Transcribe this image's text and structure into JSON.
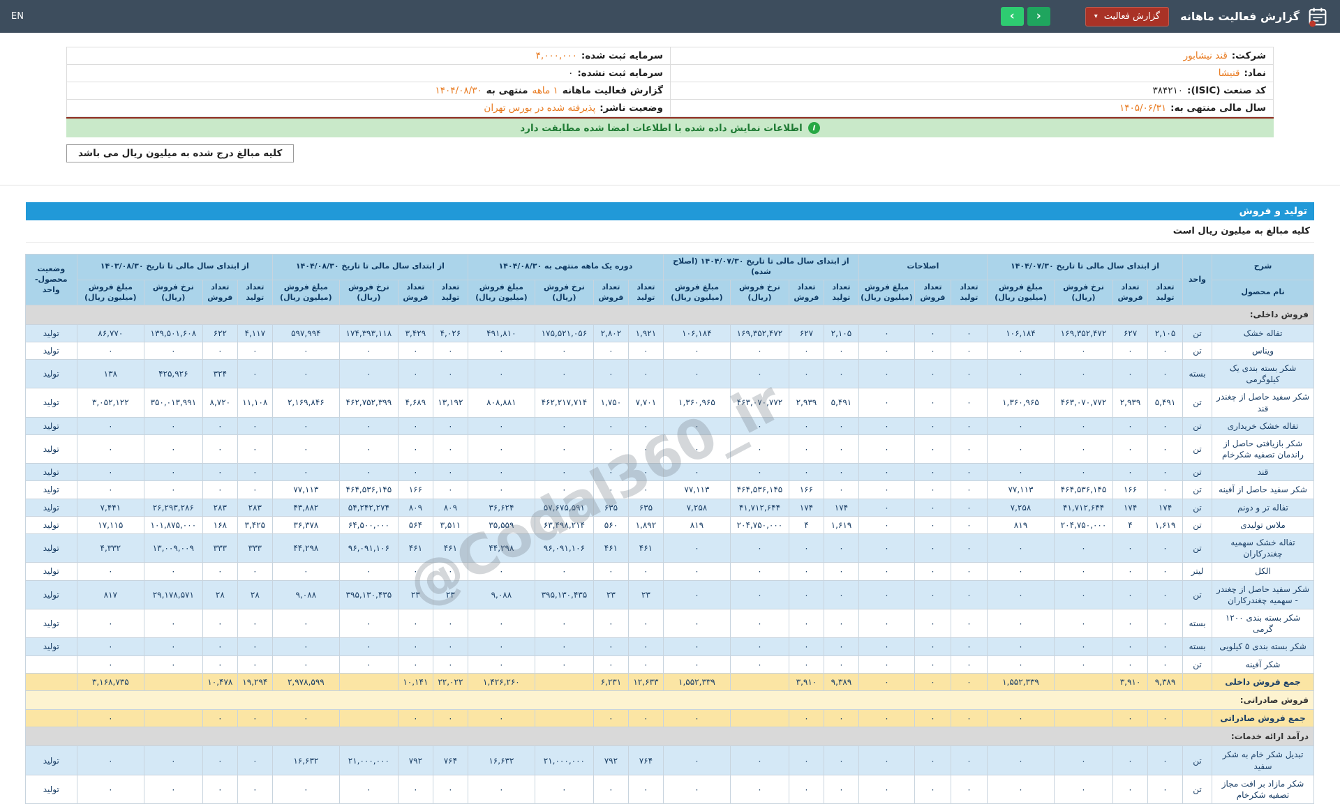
{
  "navbar": {
    "title": "گزارش فعالیت ماهانه",
    "dropdown_label": "گزارش فعالیت",
    "dropdown_caret": "▾",
    "prev_arrow": "‹",
    "next_arrow": "›",
    "lang": "EN"
  },
  "info": {
    "company_label": "شرکت:",
    "company_value": "قند نیشابور",
    "symbol_label": "نماد:",
    "symbol_value": "قنیشا",
    "isic_label": "کد صنعت (ISIC):",
    "isic_value": "۳۸۴۲۱۰",
    "fiscal_year_label": "سال مالی منتهی به:",
    "fiscal_year_value": "۱۴۰۵/۰۶/۳۱",
    "registered_capital_label": "سرمایه ثبت شده:",
    "registered_capital_value": "۴,۰۰۰,۰۰۰",
    "unregistered_capital_label": "سرمایه ثبت نشده:",
    "unregistered_capital_value": "۰",
    "report_label": "گزارش فعالیت ماهانه",
    "report_period": "۱ ماهه",
    "report_ending_label": "منتهی به",
    "report_ending_date": "۱۴۰۴/۰۸/۳۰",
    "publisher_status_label": "وضعیت ناشر:",
    "publisher_status_value": "پذیرفته شده در بورس تهران",
    "signature_notice": "اطلاعات نمایش داده شده با اطلاعات امضا شده مطابقت دارد",
    "info_icon_glyph": "i",
    "amounts_note": "کلیه مبالغ درج شده به میلیون ریال می باشد"
  },
  "section": {
    "title": "تولید و فروش",
    "subtitle": "کلیه مبالغ به میلیون ریال است"
  },
  "watermark": "@Codal360_ir",
  "colors": {
    "navbar_bg": "#3d4d5d",
    "accent_red": "#a93226",
    "accent_red_border": "#c15b4e",
    "accent_green_prev": "#1fa55e",
    "accent_green_next": "#2ecc71",
    "link_orange": "#e8791e",
    "banner_bg": "#c9e9c9",
    "banner_text": "#1e7a33",
    "banner_top_line": "#8e2a1e",
    "info_icon_green": "#27a844",
    "section_bar_blue": "#2199d8",
    "header_blue": "#abd4ea",
    "header_text": "#0f3a63",
    "row_blue": "#d4e8f6",
    "row_yellow": "#fbe5a4",
    "section_gray": "#d9d9d9",
    "section_cream": "#fdf3d0",
    "num_text": "#1b3f66",
    "grid_border": "#c8d4de"
  },
  "table": {
    "headers": {
      "sharh": "شرح",
      "product": "نام محصول",
      "unit": "واحد",
      "status_lines": [
        "وضعیت",
        "محصول-واحد"
      ],
      "sub_cols": [
        [
          "تعداد",
          "تولید"
        ],
        [
          "تعداد",
          "فروش"
        ],
        [
          "نرخ فروش",
          "(ریال)"
        ],
        [
          "مبلغ فروش",
          "(میلیون ریال)"
        ]
      ],
      "sub_cols_adj": [
        [
          "تعداد",
          "تولید"
        ],
        [
          "تعداد",
          "فروش"
        ],
        [
          "مبلغ فروش",
          "(میلیون ریال)"
        ]
      ]
    },
    "groups": [
      {
        "label": "از ابتدای سال مالی تا تاریخ ۱۴۰۴/۰۷/۳۰",
        "cols": 4
      },
      {
        "label": "اصلاحات",
        "cols": 3
      },
      {
        "label": "از ابتدای سال مالی تا تاریخ ۱۴۰۴/۰۷/۳۰ (اصلاح شده)",
        "cols": 4
      },
      {
        "label": "دوره یک ماهه منتهی به ۱۴۰۴/۰۸/۳۰",
        "cols": 4
      },
      {
        "label": "از ابتدای سال مالی تا تاریخ ۱۴۰۴/۰۸/۳۰",
        "cols": 4
      },
      {
        "label": "از ابتدای سال مالی تا تاریخ ۱۴۰۳/۰۸/۳۰",
        "cols": 4
      }
    ],
    "rows": [
      {
        "type": "section",
        "label": "فروش داخلی:",
        "tone": "gray"
      },
      {
        "type": "data",
        "name": "تفاله خشک",
        "unit": "تن",
        "status": "تولید",
        "cells": [
          "۲,۱۰۵",
          "۶۲۷",
          "۱۶۹,۳۵۲,۴۷۲",
          "۱۰۶,۱۸۴",
          "۰",
          "۰",
          "۰",
          "۲,۱۰۵",
          "۶۲۷",
          "۱۶۹,۳۵۲,۴۷۲",
          "۱۰۶,۱۸۴",
          "۱,۹۲۱",
          "۲,۸۰۲",
          "۱۷۵,۵۲۱,۰۵۶",
          "۴۹۱,۸۱۰",
          "۴,۰۲۶",
          "۳,۴۲۹",
          "۱۷۴,۳۹۳,۱۱۸",
          "۵۹۷,۹۹۴",
          "۴,۱۱۷",
          "۶۲۲",
          "۱۳۹,۵۰۱,۶۰۸",
          "۸۶,۷۷۰"
        ]
      },
      {
        "type": "data",
        "name": "ویناس",
        "unit": "تن",
        "status": "تولید",
        "cells": [
          "۰",
          "۰",
          "۰",
          "۰",
          "۰",
          "۰",
          "۰",
          "۰",
          "۰",
          "۰",
          "۰",
          "۰",
          "۰",
          "۰",
          "۰",
          "۰",
          "۰",
          "۰",
          "۰",
          "۰",
          "۰",
          "۰",
          "۰"
        ]
      },
      {
        "type": "data",
        "name": "شکر بسته بندی یک کیلوگرمی",
        "unit": "بسته",
        "status": "تولید",
        "cells": [
          "۰",
          "۰",
          "۰",
          "۰",
          "۰",
          "۰",
          "۰",
          "۰",
          "۰",
          "۰",
          "۰",
          "۰",
          "۰",
          "۰",
          "۰",
          "۰",
          "۰",
          "۰",
          "۰",
          "۰",
          "۳۲۴",
          "۴۲۵,۹۲۶",
          "۱۳۸"
        ]
      },
      {
        "type": "data",
        "name": "شکر سفید حاصل از چغندر قند",
        "unit": "تن",
        "status": "تولید",
        "cells": [
          "۵,۴۹۱",
          "۲,۹۳۹",
          "۴۶۳,۰۷۰,۷۷۲",
          "۱,۳۶۰,۹۶۵",
          "۰",
          "۰",
          "۰",
          "۵,۴۹۱",
          "۲,۹۳۹",
          "۴۶۳,۰۷۰,۷۷۲",
          "۱,۳۶۰,۹۶۵",
          "۷,۷۰۱",
          "۱,۷۵۰",
          "۴۶۲,۲۱۷,۷۱۴",
          "۸۰۸,۸۸۱",
          "۱۳,۱۹۲",
          "۴,۶۸۹",
          "۴۶۲,۷۵۲,۳۹۹",
          "۲,۱۶۹,۸۴۶",
          "۱۱,۱۰۸",
          "۸,۷۲۰",
          "۳۵۰,۰۱۳,۹۹۱",
          "۳,۰۵۲,۱۲۲"
        ]
      },
      {
        "type": "data",
        "name": "تفاله خشک خریداری",
        "unit": "تن",
        "status": "تولید",
        "cells": [
          "۰",
          "۰",
          "۰",
          "۰",
          "۰",
          "۰",
          "۰",
          "۰",
          "۰",
          "۰",
          "۰",
          "۰",
          "۰",
          "۰",
          "۰",
          "۰",
          "۰",
          "۰",
          "۰",
          "۰",
          "۰",
          "۰",
          "۰"
        ]
      },
      {
        "type": "data",
        "name": "شکر بازیافتی حاصل از راندمان تصفیه شکرخام",
        "unit": "تن",
        "status": "تولید",
        "cells": [
          "۰",
          "۰",
          "۰",
          "۰",
          "۰",
          "۰",
          "۰",
          "۰",
          "۰",
          "۰",
          "۰",
          "۰",
          "۰",
          "۰",
          "۰",
          "۰",
          "۰",
          "۰",
          "۰",
          "۰",
          "۰",
          "۰",
          "۰"
        ]
      },
      {
        "type": "data",
        "name": "قند",
        "unit": "تن",
        "status": "تولید",
        "cells": [
          "۰",
          "۰",
          "۰",
          "۰",
          "۰",
          "۰",
          "۰",
          "۰",
          "۰",
          "۰",
          "۰",
          "۰",
          "۰",
          "۰",
          "۰",
          "۰",
          "۰",
          "۰",
          "۰",
          "۰",
          "۰",
          "۰",
          "۰"
        ]
      },
      {
        "type": "data",
        "name": "شکر سفید حاصل از آفینه",
        "unit": "تن",
        "status": "تولید",
        "cells": [
          "۰",
          "۱۶۶",
          "۴۶۴,۵۳۶,۱۴۵",
          "۷۷,۱۱۳",
          "۰",
          "۰",
          "۰",
          "۰",
          "۱۶۶",
          "۴۶۴,۵۳۶,۱۴۵",
          "۷۷,۱۱۳",
          "۰",
          "۰",
          "۰",
          "۰",
          "۰",
          "۱۶۶",
          "۴۶۴,۵۳۶,۱۴۵",
          "۷۷,۱۱۳",
          "۰",
          "۰",
          "۰",
          "۰"
        ]
      },
      {
        "type": "data",
        "name": "تفاله تر و دونم",
        "unit": "تن",
        "status": "تولید",
        "cells": [
          "۱۷۴",
          "۱۷۴",
          "۴۱,۷۱۲,۶۴۴",
          "۷,۲۵۸",
          "۰",
          "۰",
          "۰",
          "۱۷۴",
          "۱۷۴",
          "۴۱,۷۱۲,۶۴۴",
          "۷,۲۵۸",
          "۶۳۵",
          "۶۳۵",
          "۵۷,۶۷۵,۵۹۱",
          "۳۶,۶۲۴",
          "۸۰۹",
          "۸۰۹",
          "۵۴,۲۴۲,۲۷۴",
          "۴۳,۸۸۲",
          "۲۸۳",
          "۲۸۳",
          "۲۶,۲۹۳,۲۸۶",
          "۷,۴۴۱"
        ]
      },
      {
        "type": "data",
        "name": "ملاس تولیدی",
        "unit": "تن",
        "status": "تولید",
        "cells": [
          "۱,۶۱۹",
          "۴",
          "۲۰۴,۷۵۰,۰۰۰",
          "۸۱۹",
          "۰",
          "۰",
          "۰",
          "۱,۶۱۹",
          "۴",
          "۲۰۴,۷۵۰,۰۰۰",
          "۸۱۹",
          "۱,۸۹۲",
          "۵۶۰",
          "۶۳,۴۹۸,۲۱۴",
          "۳۵,۵۵۹",
          "۳,۵۱۱",
          "۵۶۴",
          "۶۴,۵۰۰,۰۰۰",
          "۳۶,۳۷۸",
          "۳,۴۲۵",
          "۱۶۸",
          "۱۰۱,۸۷۵,۰۰۰",
          "۱۷,۱۱۵"
        ]
      },
      {
        "type": "data",
        "name": "تفاله خشک سهمیه چغندرکاران",
        "unit": "تن",
        "status": "تولید",
        "cells": [
          "۰",
          "۰",
          "۰",
          "۰",
          "۰",
          "۰",
          "۰",
          "۰",
          "۰",
          "۰",
          "۰",
          "۴۶۱",
          "۴۶۱",
          "۹۶,۰۹۱,۱۰۶",
          "۴۴,۲۹۸",
          "۴۶۱",
          "۴۶۱",
          "۹۶,۰۹۱,۱۰۶",
          "۴۴,۲۹۸",
          "۳۳۳",
          "۳۳۳",
          "۱۳,۰۰۹,۰۰۹",
          "۴,۳۳۲"
        ]
      },
      {
        "type": "data",
        "name": "الکل",
        "unit": "لیتر",
        "status": "تولید",
        "cells": [
          "۰",
          "۰",
          "۰",
          "۰",
          "۰",
          "۰",
          "۰",
          "۰",
          "۰",
          "۰",
          "۰",
          "۰",
          "۰",
          "۰",
          "۰",
          "۰",
          "۰",
          "۰",
          "۰",
          "۰",
          "۰",
          "۰",
          "۰"
        ]
      },
      {
        "type": "data",
        "name": "شکر سفید حاصل از چغندر - سهمیه چغندرکاران",
        "unit": "تن",
        "status": "تولید",
        "cells": [
          "۰",
          "۰",
          "۰",
          "۰",
          "۰",
          "۰",
          "۰",
          "۰",
          "۰",
          "۰",
          "۰",
          "۲۳",
          "۲۳",
          "۳۹۵,۱۳۰,۴۳۵",
          "۹,۰۸۸",
          "۲۳",
          "۲۳",
          "۳۹۵,۱۳۰,۴۳۵",
          "۹,۰۸۸",
          "۲۸",
          "۲۸",
          "۲۹,۱۷۸,۵۷۱",
          "۸۱۷"
        ]
      },
      {
        "type": "data",
        "name": "شکر بسته بندی ۱۲۰۰ گرمی",
        "unit": "بسته",
        "status": "تولید",
        "cells": [
          "۰",
          "۰",
          "۰",
          "۰",
          "۰",
          "۰",
          "۰",
          "۰",
          "۰",
          "۰",
          "۰",
          "۰",
          "۰",
          "۰",
          "۰",
          "۰",
          "۰",
          "۰",
          "۰",
          "۰",
          "۰",
          "۰",
          "۰"
        ]
      },
      {
        "type": "data",
        "name": "شکر بسته بندی ۵ کیلویی",
        "unit": "بسته",
        "status": "تولید",
        "cells": [
          "۰",
          "۰",
          "۰",
          "۰",
          "۰",
          "۰",
          "۰",
          "۰",
          "۰",
          "۰",
          "۰",
          "۰",
          "۰",
          "۰",
          "۰",
          "۰",
          "۰",
          "۰",
          "۰",
          "۰",
          "۰",
          "۰",
          "۰"
        ]
      },
      {
        "type": "data",
        "name": "شکر آفینه",
        "unit": "تن",
        "status": "",
        "cells": [
          "۰",
          "۰",
          "۰",
          "۰",
          "۰",
          "۰",
          "۰",
          "۰",
          "۰",
          "۰",
          "۰",
          "۰",
          "۰",
          "۰",
          "۰",
          "۰",
          "۰",
          "۰",
          "۰",
          "۰",
          "۰",
          "۰",
          "۰"
        ]
      },
      {
        "type": "total",
        "name": "جمع فروش داخلی",
        "unit": "",
        "status": "",
        "cells": [
          "۹,۳۸۹",
          "۳,۹۱۰",
          "",
          "۱,۵۵۲,۳۳۹",
          "۰",
          "۰",
          "۰",
          "۹,۳۸۹",
          "۳,۹۱۰",
          "",
          "۱,۵۵۲,۳۳۹",
          "۱۲,۶۳۳",
          "۶,۲۳۱",
          "",
          "۱,۴۲۶,۲۶۰",
          "۲۲,۰۲۲",
          "۱۰,۱۴۱",
          "",
          "۲,۹۷۸,۵۹۹",
          "۱۹,۲۹۴",
          "۱۰,۴۷۸",
          "",
          "۳,۱۶۸,۷۳۵"
        ]
      },
      {
        "type": "section",
        "label": "فروش صادراتی:",
        "tone": "cream"
      },
      {
        "type": "total",
        "name": "جمع فروش صادراتی",
        "unit": "",
        "status": "",
        "cells": [
          "۰",
          "۰",
          "",
          "۰",
          "۰",
          "۰",
          "۰",
          "۰",
          "۰",
          "",
          "۰",
          "۰",
          "۰",
          "",
          "۰",
          "۰",
          "۰",
          "",
          "۰",
          "۰",
          "۰",
          "",
          "۰"
        ]
      },
      {
        "type": "section",
        "label": "درآمد ارائه خدمات:",
        "tone": "gray"
      },
      {
        "type": "data",
        "name": "تبدیل شکر خام به شکر سفید",
        "unit": "تن",
        "status": "تولید",
        "cells": [
          "۰",
          "۰",
          "۰",
          "۰",
          "۰",
          "۰",
          "۰",
          "۰",
          "۰",
          "۰",
          "۰",
          "۷۶۴",
          "۷۹۲",
          "۲۱,۰۰۰,۰۰۰",
          "۱۶,۶۳۲",
          "۷۶۴",
          "۷۹۲",
          "۲۱,۰۰۰,۰۰۰",
          "۱۶,۶۳۲",
          "۰",
          "۰",
          "۰",
          "۰"
        ]
      },
      {
        "type": "data",
        "name": "شکر مازاد بر افت مجاز تصفیه شکرخام",
        "unit": "تن",
        "status": "تولید",
        "cells": [
          "۰",
          "۰",
          "۰",
          "۰",
          "۰",
          "۰",
          "۰",
          "۰",
          "۰",
          "۰",
          "۰",
          "۰",
          "۰",
          "۰",
          "۰",
          "۰",
          "۰",
          "۰",
          "۰",
          "۰",
          "۰",
          "۰",
          "۰"
        ]
      }
    ]
  }
}
